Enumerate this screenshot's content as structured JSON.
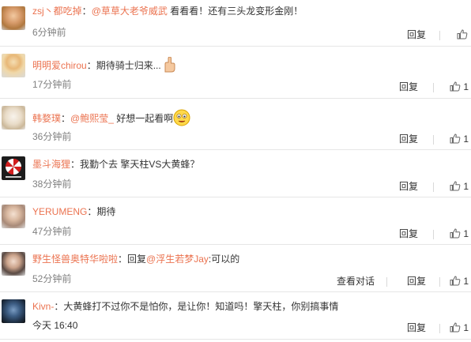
{
  "comments": [
    {
      "user": "zsj丶都吃掉",
      "colon": "：",
      "mention": "@草草大老爷威武",
      "text": " 看看看！还有三头龙变形金刚！",
      "time": "6分钟前",
      "reply": "回复",
      "likes": ""
    },
    {
      "user": "明明爱chirou",
      "colon": "：",
      "mention": "",
      "text": "期待骑士归来...",
      "time": "17分钟前",
      "reply": "回复",
      "likes": "1"
    },
    {
      "user": "韩婺璞",
      "colon": "：",
      "mention": "@鲍熙莹_",
      "text": " 好想一起看啊",
      "time": "36分钟前",
      "reply": "回复",
      "likes": "1"
    },
    {
      "user": "墨斗海狸",
      "colon": "：",
      "mention": "",
      "text": "我勤个去 擎天柱VS大黄蜂？",
      "time": "38分钟前",
      "reply": "回复",
      "likes": "1"
    },
    {
      "user": "YERUMENG",
      "colon": "：",
      "mention": "",
      "text": "期待",
      "time": "47分钟前",
      "reply": "回复",
      "likes": "1"
    },
    {
      "user": "野生怪兽奥特华啦啦",
      "colon": "：",
      "mention": "",
      "text": "回复",
      "mention2": "@浮生若梦Jay",
      "text2": ":可以的",
      "time": "52分钟前",
      "view_conv": "查看对话",
      "reply": "回复",
      "likes": "1"
    },
    {
      "user": "Kivn-",
      "colon": "：",
      "mention": "",
      "text": "大黄蜂打不过你不是怕你，是让你！知道吗！擎天柱，你别搞事情",
      "time": "今天 16:40",
      "reply": "回复",
      "likes": "1"
    }
  ]
}
